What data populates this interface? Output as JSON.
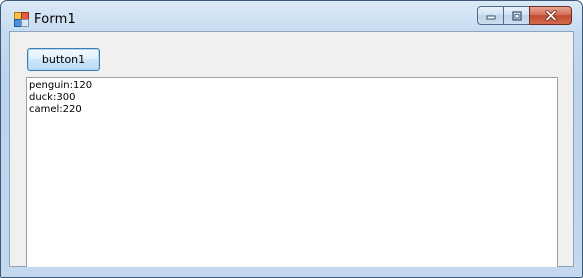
{
  "window": {
    "title": "Form1",
    "icon": "windows-form-icon",
    "caption_buttons": [
      "minimize-icon",
      "maximize-icon",
      "close-icon"
    ],
    "colors": {
      "frame": "#c4d9ef",
      "client": "#f0f0f0",
      "close_button": "#c24a30"
    }
  },
  "form": {
    "button_label": "button1",
    "list_items": [
      "penguin:120",
      "duck:300",
      "camel:220"
    ]
  }
}
